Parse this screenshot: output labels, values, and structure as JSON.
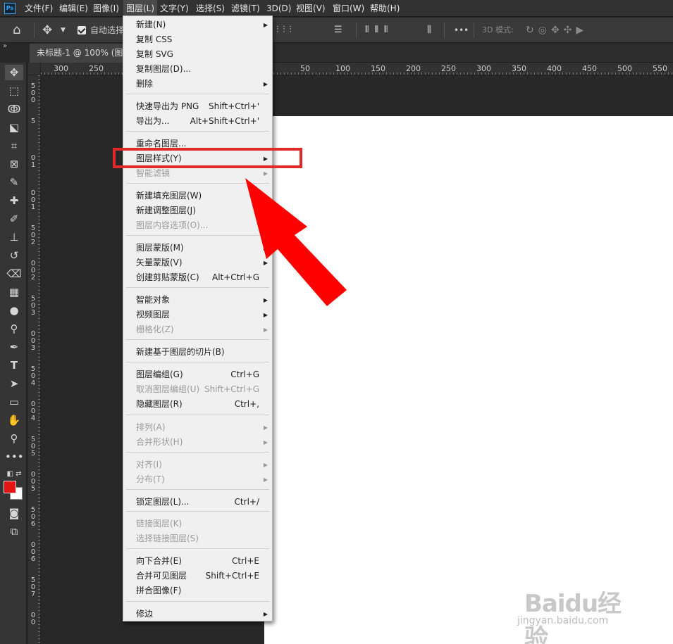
{
  "app": {
    "logo_text": "Ps"
  },
  "menubar": {
    "items": [
      "文件(F)",
      "编辑(E)",
      "图像(I)",
      "图层(L)",
      "文字(Y)",
      "选择(S)",
      "滤镜(T)",
      "3D(D)",
      "视图(V)",
      "窗口(W)",
      "帮助(H)"
    ]
  },
  "options_bar": {
    "auto_select_label": "自动选择",
    "mode_3d_label": "3D 模式:",
    "more_label": "•••"
  },
  "document_tab": {
    "title": "未标题-1 @ 100% (图层"
  },
  "ruler_top_ticks": [
    "300",
    "250",
    "50",
    "100",
    "150",
    "200",
    "250",
    "300",
    "350",
    "400",
    "450",
    "500",
    "550"
  ],
  "ruler_left_ticks": [
    "5",
    "0",
    "0",
    "5",
    "0",
    "1",
    "0",
    "0",
    "1",
    "5",
    "0",
    "2",
    "0",
    "0",
    "2",
    "5",
    "0",
    "3",
    "0",
    "0",
    "3",
    "5",
    "0",
    "4",
    "0",
    "0",
    "4",
    "5",
    "0",
    "5",
    "0",
    "0",
    "5",
    "5",
    "0",
    "6",
    "0",
    "0",
    "6",
    "5",
    "0",
    "7",
    "0",
    "0"
  ],
  "colors": {
    "foreground": "#e21414",
    "background": "#ffffff",
    "annotation": "#e02a2a",
    "menu_bg": "#f0f0f0"
  },
  "layer_menu": {
    "items": [
      {
        "label": "新建(N)",
        "shortcut": "",
        "submenu": true,
        "disabled": false
      },
      {
        "label": "复制 CSS",
        "shortcut": "",
        "submenu": false,
        "disabled": false
      },
      {
        "label": "复制 SVG",
        "shortcut": "",
        "submenu": false,
        "disabled": false
      },
      {
        "label": "复制图层(D)...",
        "shortcut": "",
        "submenu": false,
        "disabled": false
      },
      {
        "label": "删除",
        "shortcut": "",
        "submenu": true,
        "disabled": false
      },
      {
        "label": "快速导出为 PNG",
        "shortcut": "Shift+Ctrl+'",
        "submenu": false,
        "disabled": false
      },
      {
        "label": "导出为...",
        "shortcut": "Alt+Shift+Ctrl+'",
        "submenu": false,
        "disabled": false
      },
      {
        "label": "重命名图层...",
        "shortcut": "",
        "submenu": false,
        "disabled": false
      },
      {
        "label": "图层样式(Y)",
        "shortcut": "",
        "submenu": true,
        "disabled": false
      },
      {
        "label": "智能滤镜",
        "shortcut": "",
        "submenu": true,
        "disabled": true
      },
      {
        "label": "新建填充图层(W)",
        "shortcut": "",
        "submenu": true,
        "disabled": false
      },
      {
        "label": "新建调整图层(J)",
        "shortcut": "",
        "submenu": false,
        "disabled": false
      },
      {
        "label": "图层内容选项(O)...",
        "shortcut": "",
        "submenu": false,
        "disabled": true
      },
      {
        "label": "图层蒙版(M)",
        "shortcut": "",
        "submenu": true,
        "disabled": false
      },
      {
        "label": "矢量蒙版(V)",
        "shortcut": "",
        "submenu": true,
        "disabled": false
      },
      {
        "label": "创建剪贴蒙版(C)",
        "shortcut": "Alt+Ctrl+G",
        "submenu": false,
        "disabled": false
      },
      {
        "label": "智能对象",
        "shortcut": "",
        "submenu": true,
        "disabled": false
      },
      {
        "label": "视频图层",
        "shortcut": "",
        "submenu": true,
        "disabled": false
      },
      {
        "label": "栅格化(Z)",
        "shortcut": "",
        "submenu": true,
        "disabled": true
      },
      {
        "label": "新建基于图层的切片(B)",
        "shortcut": "",
        "submenu": false,
        "disabled": false
      },
      {
        "label": "图层编组(G)",
        "shortcut": "Ctrl+G",
        "submenu": false,
        "disabled": false
      },
      {
        "label": "取消图层编组(U)",
        "shortcut": "Shift+Ctrl+G",
        "submenu": false,
        "disabled": true
      },
      {
        "label": "隐藏图层(R)",
        "shortcut": "Ctrl+,",
        "submenu": false,
        "disabled": false
      },
      {
        "label": "排列(A)",
        "shortcut": "",
        "submenu": true,
        "disabled": true
      },
      {
        "label": "合并形状(H)",
        "shortcut": "",
        "submenu": true,
        "disabled": true
      },
      {
        "label": "对齐(I)",
        "shortcut": "",
        "submenu": true,
        "disabled": true
      },
      {
        "label": "分布(T)",
        "shortcut": "",
        "submenu": true,
        "disabled": true
      },
      {
        "label": "锁定图层(L)...",
        "shortcut": "Ctrl+/",
        "submenu": false,
        "disabled": false
      },
      {
        "label": "链接图层(K)",
        "shortcut": "",
        "submenu": false,
        "disabled": true
      },
      {
        "label": "选择链接图层(S)",
        "shortcut": "",
        "submenu": false,
        "disabled": true
      },
      {
        "label": "向下合并(E)",
        "shortcut": "Ctrl+E",
        "submenu": false,
        "disabled": false
      },
      {
        "label": "合并可见图层",
        "shortcut": "Shift+Ctrl+E",
        "submenu": false,
        "disabled": false
      },
      {
        "label": "拼合图像(F)",
        "shortcut": "",
        "submenu": false,
        "disabled": false
      },
      {
        "label": "修边",
        "shortcut": "",
        "submenu": true,
        "disabled": false
      }
    ]
  },
  "watermark": {
    "text": "Baidu经验",
    "sub": "jingyan.baidu.com"
  }
}
